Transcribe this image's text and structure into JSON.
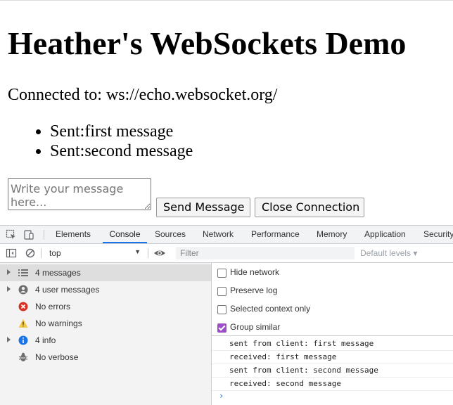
{
  "page": {
    "heading": "Heather's WebSockets Demo",
    "status": "Connected to: ws://echo.websocket.org/",
    "messages": [
      "Sent:first message",
      "Sent:second message"
    ],
    "input_placeholder": "Write your message here...",
    "send_label": "Send Message",
    "close_label": "Close Connection"
  },
  "devtools": {
    "tabs": [
      "Elements",
      "Console",
      "Sources",
      "Network",
      "Performance",
      "Memory",
      "Application",
      "Security"
    ],
    "active_tab": "Console",
    "context": "top",
    "filter_placeholder": "Filter",
    "levels_label": "Default levels ▾",
    "sidebar": [
      {
        "label": "4 messages",
        "icon": "list-icon",
        "expandable": true,
        "selected": true
      },
      {
        "label": "4 user messages",
        "icon": "user-icon",
        "expandable": true,
        "selected": false
      },
      {
        "label": "No errors",
        "icon": "error-icon",
        "expandable": false,
        "selected": false
      },
      {
        "label": "No warnings",
        "icon": "warning-icon",
        "expandable": false,
        "selected": false
      },
      {
        "label": "4 info",
        "icon": "info-icon",
        "expandable": true,
        "selected": false
      },
      {
        "label": "No verbose",
        "icon": "verbose-icon",
        "expandable": false,
        "selected": false
      }
    ],
    "settings": [
      {
        "label": "Hide network",
        "checked": false
      },
      {
        "label": "Preserve log",
        "checked": false
      },
      {
        "label": "Selected context only",
        "checked": false
      },
      {
        "label": "Group similar",
        "checked": true
      }
    ],
    "logs": [
      "sent from client: first message",
      "received: first message",
      "sent from client: second message",
      "received: second message"
    ],
    "prompt_symbol": "›"
  },
  "colors": {
    "accent": "#1a73e8",
    "checkbox_checked": "#9b4ec7",
    "error": "#d93025",
    "warning": "#f2c94c",
    "info": "#1a73e8"
  }
}
